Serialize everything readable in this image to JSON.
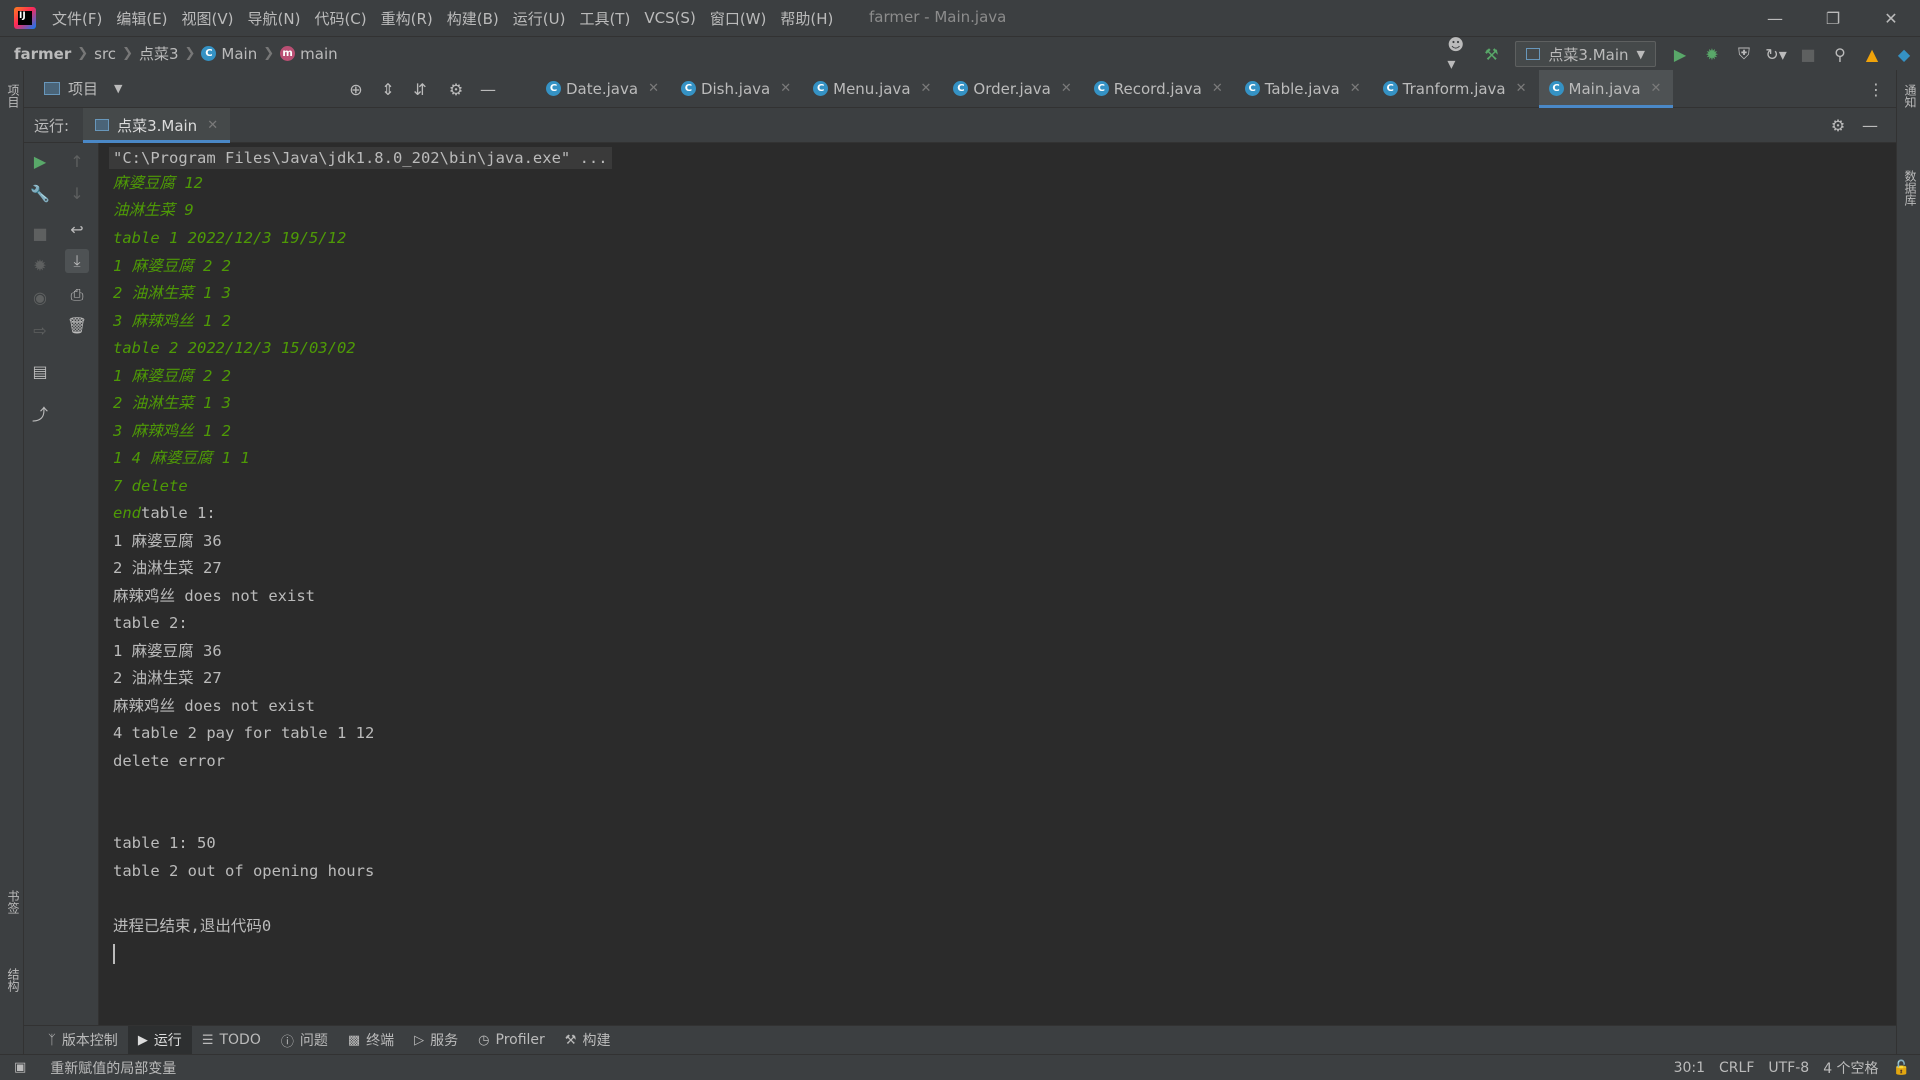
{
  "menu": {
    "items": [
      "文件(F)",
      "编辑(E)",
      "视图(V)",
      "导航(N)",
      "代码(C)",
      "重构(R)",
      "构建(B)",
      "运行(U)",
      "工具(T)",
      "VCS(S)",
      "窗口(W)",
      "帮助(H)"
    ],
    "title": "farmer - Main.java"
  },
  "breadcrumb": {
    "project": "farmer",
    "src": "src",
    "package": "点菜3",
    "class": "Main",
    "method": "main"
  },
  "toolbar": {
    "run_config": "点菜3.Main"
  },
  "project_panel": {
    "label": "项目"
  },
  "editor_tabs": [
    {
      "label": "Date.java"
    },
    {
      "label": "Dish.java"
    },
    {
      "label": "Menu.java"
    },
    {
      "label": "Order.java"
    },
    {
      "label": "Record.java"
    },
    {
      "label": "Table.java"
    },
    {
      "label": "Tranform.java"
    },
    {
      "label": "Main.java"
    }
  ],
  "left_strip": {
    "project": "项目",
    "bookmarks": "书签",
    "structure": "结构"
  },
  "right_strip": {
    "notifications": "通知",
    "database": "数据库"
  },
  "run_window": {
    "label": "运行:",
    "tab": "点菜3.Main"
  },
  "console": {
    "lines": [
      {
        "text": "\"C:\\Program Files\\Java\\jdk1.8.0_202\\bin\\java.exe\" ...",
        "type": "cmd"
      },
      {
        "text": "麻婆豆腐 12",
        "type": "in"
      },
      {
        "text": "油淋生菜 9",
        "type": "in"
      },
      {
        "text": "table 1 2022/12/3 19/5/12",
        "type": "in"
      },
      {
        "text": "1 麻婆豆腐 2 2",
        "type": "in"
      },
      {
        "text": "2 油淋生菜 1 3",
        "type": "in"
      },
      {
        "text": "3 麻辣鸡丝 1 2",
        "type": "in"
      },
      {
        "text": "table 2 2022/12/3 15/03/02",
        "type": "in"
      },
      {
        "text": "1 麻婆豆腐 2 2",
        "type": "in"
      },
      {
        "text": "2 油淋生菜 1 3",
        "type": "in"
      },
      {
        "text": "3 麻辣鸡丝 1 2",
        "type": "in"
      },
      {
        "text": "1 4 麻婆豆腐 1 1",
        "type": "in"
      },
      {
        "text": "7 delete",
        "type": "in"
      },
      {
        "text": "table 1:",
        "type": "mixed",
        "prefix": "end"
      },
      {
        "text": "1 麻婆豆腐 36",
        "type": "out"
      },
      {
        "text": "2 油淋生菜 27",
        "type": "out"
      },
      {
        "text": "麻辣鸡丝 does not exist",
        "type": "out"
      },
      {
        "text": "table 2:",
        "type": "out"
      },
      {
        "text": "1 麻婆豆腐 36",
        "type": "out"
      },
      {
        "text": "2 油淋生菜 27",
        "type": "out"
      },
      {
        "text": "麻辣鸡丝 does not exist",
        "type": "out"
      },
      {
        "text": "4 table 2 pay for table 1 12",
        "type": "out"
      },
      {
        "text": "delete error",
        "type": "out"
      },
      {
        "text": "",
        "type": "out"
      },
      {
        "text": "",
        "type": "out"
      },
      {
        "text": "table 1: 50",
        "type": "out"
      },
      {
        "text": "table 2 out of opening hours",
        "type": "out"
      },
      {
        "text": "",
        "type": "out"
      },
      {
        "text": "进程已结束,退出代码0",
        "type": "out"
      }
    ]
  },
  "bottom_tabs": [
    {
      "label": "版本控制",
      "icon": "branch-icon"
    },
    {
      "label": "运行",
      "icon": "run-icon"
    },
    {
      "label": "TODO",
      "icon": "list-icon"
    },
    {
      "label": "问题",
      "icon": "problems-icon"
    },
    {
      "label": "终端",
      "icon": "terminal-icon"
    },
    {
      "label": "服务",
      "icon": "services-icon"
    },
    {
      "label": "Profiler",
      "icon": "profiler-icon"
    },
    {
      "label": "构建",
      "icon": "hammer-icon"
    }
  ],
  "status": {
    "message": "重新赋值的局部变量",
    "position": "30:1",
    "line_ending": "CRLF",
    "encoding": "UTF-8",
    "indent": "4 个空格"
  },
  "colors": {
    "input_text": "#4e9a06",
    "output_text": "#bbbbbb",
    "accent": "#4a88c7"
  }
}
